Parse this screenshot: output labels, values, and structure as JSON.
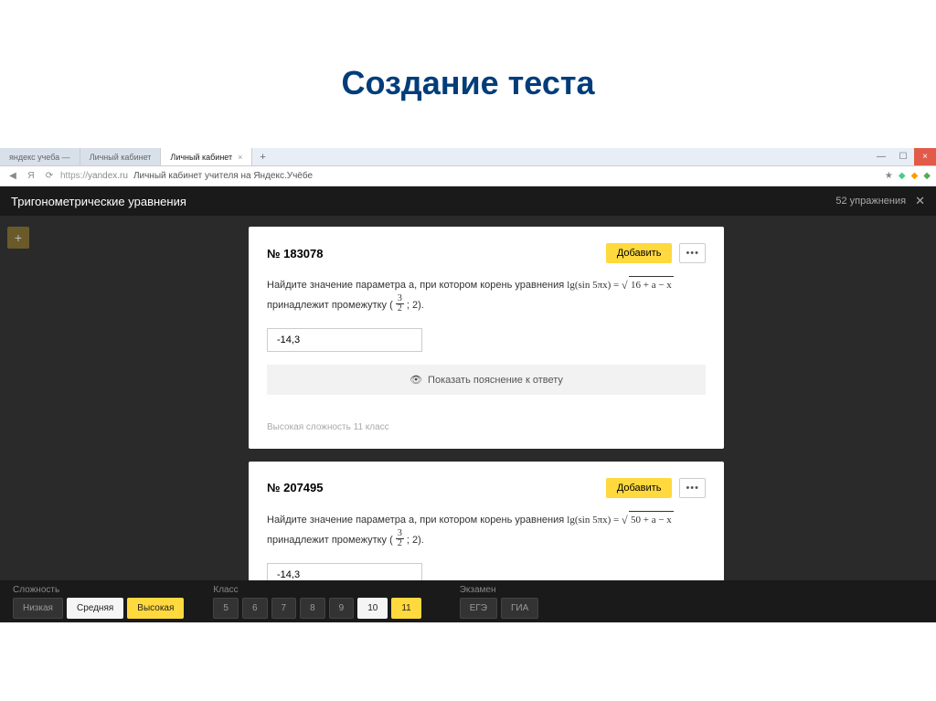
{
  "slide": {
    "title": "Создание теста"
  },
  "browser": {
    "tabs": [
      {
        "label": "яндекс учеба —"
      },
      {
        "label": "Личный кабинет"
      },
      {
        "label": "Личный кабинет"
      }
    ],
    "url_protocol": "https://",
    "url_domain": "yandex.ru",
    "url_title": "Личный кабинет учителя на Яндекс.Учёбе"
  },
  "app": {
    "title": "Тригонометрические уравнения",
    "count_label": "52 упражнения"
  },
  "cards": [
    {
      "number": "№ 183078",
      "add_label": "Добавить",
      "problem_prefix": "Найдите значение параметра a, при котором корень уравнения ",
      "formula_lhs": "lg(sin 5πx) = ",
      "sqrt_content": "16 + a − x",
      "problem_mid": "принадлежит промежутку (",
      "frac_num": "3",
      "frac_den": "2",
      "problem_tail": "; 2).",
      "answer": "-14,3",
      "expand_label": "Показать пояснение к ответу",
      "footer": "Высокая сложность   11 класс"
    },
    {
      "number": "№ 207495",
      "add_label": "Добавить",
      "problem_prefix": "Найдите значение параметра a, при котором корень уравнения ",
      "formula_lhs": "lg(sin 5πx) = ",
      "sqrt_content": "50 + a − x",
      "problem_mid": "принадлежит промежутку (",
      "frac_num": "3",
      "frac_den": "2",
      "problem_tail": "; 2).",
      "answer": "-14,3"
    }
  ],
  "filters": {
    "difficulty_label": "Сложность",
    "difficulty": [
      {
        "label": "Низкая",
        "state": ""
      },
      {
        "label": "Средняя",
        "state": "active-white"
      },
      {
        "label": "Высокая",
        "state": "active-yellow"
      }
    ],
    "class_label": "Класс",
    "classes": [
      {
        "label": "5",
        "state": ""
      },
      {
        "label": "6",
        "state": ""
      },
      {
        "label": "7",
        "state": ""
      },
      {
        "label": "8",
        "state": ""
      },
      {
        "label": "9",
        "state": ""
      },
      {
        "label": "10",
        "state": "active-white"
      },
      {
        "label": "11",
        "state": "active-yellow"
      }
    ],
    "exam_label": "Экзамен",
    "exams": [
      {
        "label": "ЕГЭ",
        "state": ""
      },
      {
        "label": "ГИА",
        "state": ""
      }
    ]
  }
}
